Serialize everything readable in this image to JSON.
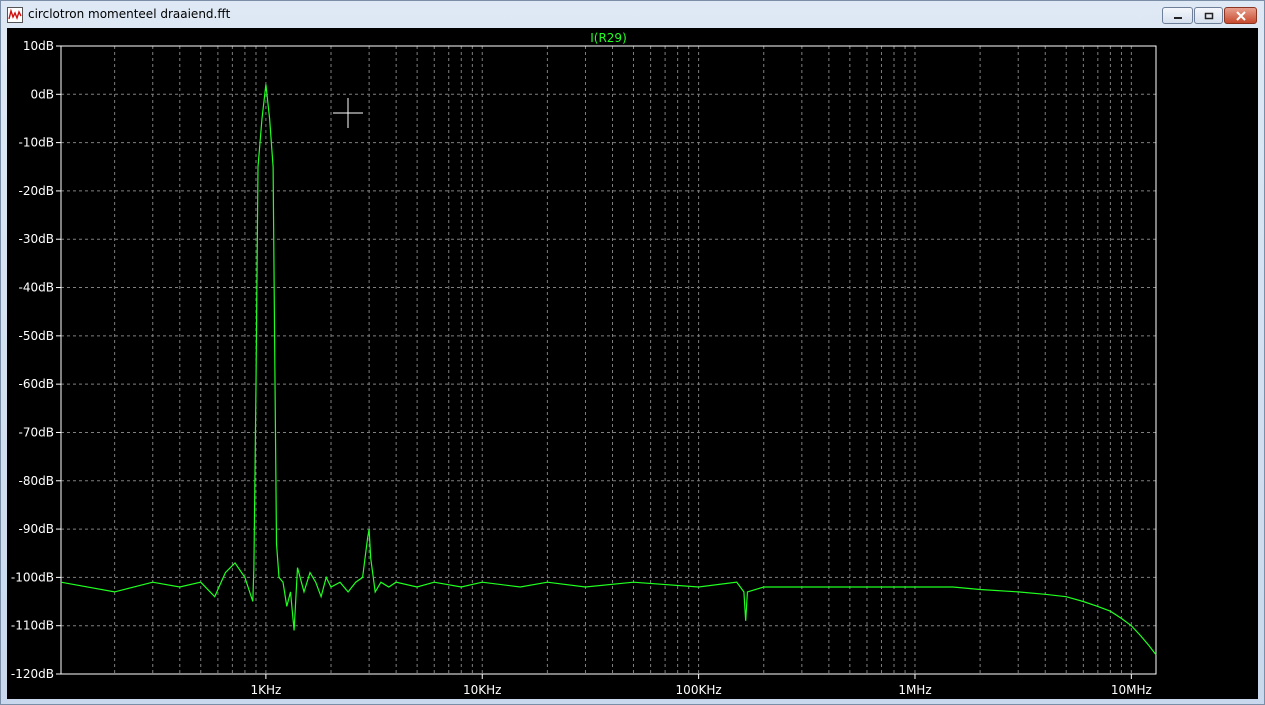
{
  "window": {
    "title": "circlotron momenteel draaiend.fft",
    "icon": "waveform-icon"
  },
  "colors": {
    "trace": "#20ff20",
    "grid": "#7f7f7f",
    "background": "#000000",
    "axis_text": "#ffffff"
  },
  "chart_data": {
    "type": "line",
    "title": "I(R29)",
    "xscale": "log",
    "xlim": [
      113,
      13000000
    ],
    "ylim": [
      -120,
      10
    ],
    "grid": true,
    "yticks": [
      10,
      0,
      -10,
      -20,
      -30,
      -40,
      -50,
      -60,
      -70,
      -80,
      -90,
      -100,
      -110,
      -120
    ],
    "ytick_labels": [
      "10dB",
      "0dB",
      "-10dB",
      "-20dB",
      "-30dB",
      "-40dB",
      "-50dB",
      "-60dB",
      "-70dB",
      "-80dB",
      "-90dB",
      "-100dB",
      "-110dB",
      "-120dB"
    ],
    "xticks": [
      1000,
      10000,
      100000,
      1000000,
      10000000
    ],
    "xtick_labels": [
      "1KHz",
      "10KHz",
      "100KHz",
      "1MHz",
      "10MHz"
    ],
    "series": [
      {
        "name": "I(R29)",
        "x": [
          113,
          200,
          300,
          400,
          500,
          580,
          650,
          720,
          800,
          870,
          880,
          900,
          920,
          960,
          1000,
          1040,
          1080,
          1100,
          1120,
          1150,
          1200,
          1250,
          1300,
          1350,
          1400,
          1500,
          1600,
          1700,
          1800,
          1900,
          2000,
          2200,
          2400,
          2600,
          2800,
          2950,
          3000,
          3050,
          3200,
          3400,
          3700,
          4000,
          5000,
          6000,
          8000,
          10000,
          15000,
          20000,
          30000,
          50000,
          100000,
          150000,
          162000,
          165000,
          168000,
          200000,
          300000,
          500000,
          1000000,
          1500000,
          2000000,
          3000000,
          4000000,
          5000000,
          6000000,
          7000000,
          8000000,
          9000000,
          10000000,
          11000000,
          12000000,
          13000000
        ],
        "y": [
          -101,
          -103,
          -101,
          -102,
          -101,
          -104,
          -99,
          -97,
          -100,
          -105,
          -98,
          -60,
          -15,
          -5,
          2,
          -5,
          -15,
          -55,
          -93,
          -100,
          -101,
          -106,
          -103,
          -111,
          -98,
          -103,
          -99,
          -101,
          -104,
          -100,
          -102,
          -101,
          -103,
          -101,
          -100,
          -92,
          -90,
          -96,
          -103,
          -101,
          -102,
          -101,
          -102,
          -101,
          -102,
          -101,
          -102,
          -101,
          -102,
          -101,
          -102,
          -101,
          -103,
          -109,
          -103,
          -102,
          -102,
          -102,
          -102,
          -102,
          -102.5,
          -103,
          -103.5,
          -104,
          -105,
          -106,
          -107,
          -108.5,
          -110,
          -112,
          -114,
          -116
        ]
      }
    ]
  }
}
